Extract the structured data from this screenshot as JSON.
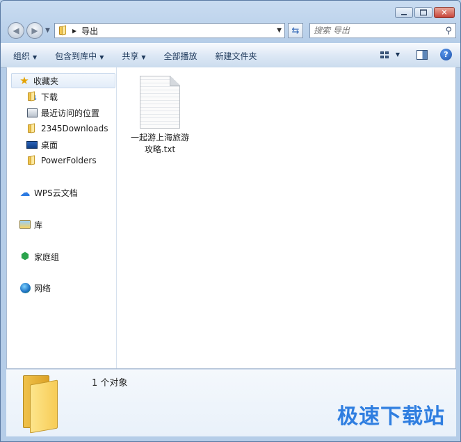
{
  "address": {
    "current": "导出"
  },
  "search": {
    "placeholder": "搜索 导出"
  },
  "toolbar": {
    "organize": "组织",
    "include_in_library": "包含到库中",
    "share": "共享",
    "play_all": "全部播放",
    "new_folder": "新建文件夹"
  },
  "sidebar": {
    "favorites": "收藏夹",
    "downloads": "下载",
    "recent": "最近访问的位置",
    "folder_2345": "2345Downloads",
    "desktop": "桌面",
    "powerfolders": "PowerFolders",
    "wps_cloud": "WPS云文档",
    "libraries": "库",
    "homegroup": "家庭组",
    "network": "网络"
  },
  "files": [
    {
      "name_line1": "一起游上海旅游",
      "name_line2": "攻略.txt"
    }
  ],
  "details": {
    "count": "1 个对象"
  },
  "watermark": "极速下载站"
}
